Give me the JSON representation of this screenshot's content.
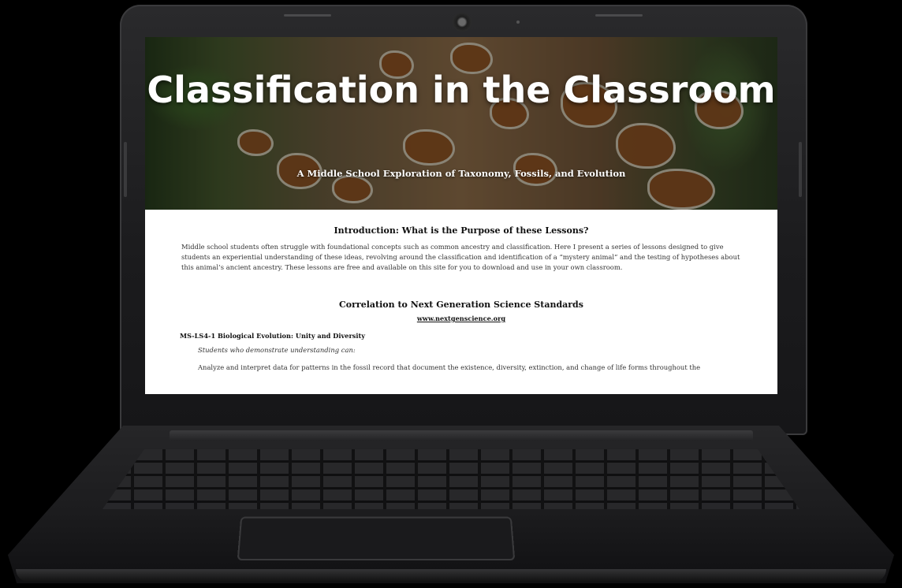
{
  "page": {
    "hero": {
      "title": "Classification in the Classroom",
      "subtitle": "A Middle School Exploration of Taxonomy, Fossils, and Evolution"
    },
    "intro": {
      "heading": "Introduction: What is the Purpose of these Lessons?",
      "body": "Middle school students often struggle with foundational concepts such as common ancestry and classification. Here I present a series of lessons designed to give students an experiential understanding of these ideas, revolving around the classification and identification of a “mystery animal” and the testing of hypotheses about this animal’s ancient ancestry. These lessons are free and available on this site for you to download and use in your own classroom."
    },
    "standards": {
      "heading": "Correlation to Next Generation Science Standards",
      "link": "www.nextgenscience.org",
      "code_title": "MS-LS4-1 Biological Evolution: Unity and Diversity",
      "lead": "Students who demonstrate understanding can:",
      "text": "Analyze and interpret data for patterns in the fossil record that document the existence, diversity, extinction, and change of life forms throughout the"
    }
  },
  "colors": {
    "background": "#000000",
    "laptop": "#1e1e20",
    "page": "#ffffff",
    "text": "#222222"
  }
}
